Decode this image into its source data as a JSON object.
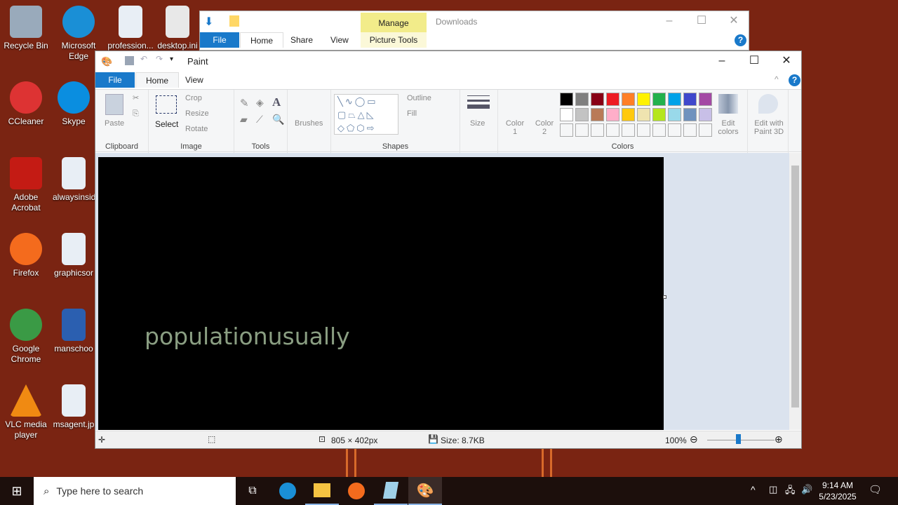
{
  "desktop": {
    "icons": [
      {
        "label": "Recycle Bin",
        "color": "#9ab"
      },
      {
        "label": "Microsoft Edge",
        "color": "#1a8fd6"
      },
      {
        "label": "profession...",
        "color": "#e8eef5"
      },
      {
        "label": "desktop.ini",
        "color": "#e8e8e8"
      },
      {
        "label": "CCleaner",
        "color": "#d33"
      },
      {
        "label": "Skype",
        "color": "#0a8ee0"
      },
      {
        "label": "Adobe Acrobat",
        "color": "#c41b14"
      },
      {
        "label": "alwaysinsid",
        "color": "#e8eef5"
      },
      {
        "label": "Firefox",
        "color": "#f46b1d"
      },
      {
        "label": "graphicsor",
        "color": "#e8eef5"
      },
      {
        "label": "Google Chrome",
        "color": "#3a9a45"
      },
      {
        "label": "manschoo",
        "color": "#2b5fb0"
      },
      {
        "label": "VLC media player",
        "color": "#f08a12"
      },
      {
        "label": "msagent.jp",
        "color": "#e8eef5"
      }
    ]
  },
  "explorer": {
    "manage": "Manage",
    "title": "Downloads",
    "tabs": [
      "File",
      "Home",
      "Share",
      "View"
    ],
    "picture_tools": "Picture Tools"
  },
  "paint": {
    "title": "Paint",
    "tabs": [
      "File",
      "Home",
      "View"
    ],
    "clipboard": {
      "paste": "Paste",
      "label": "Clipboard"
    },
    "image": {
      "select": "Select",
      "crop": "Crop",
      "resize": "Resize",
      "rotate": "Rotate",
      "label": "Image"
    },
    "tools": {
      "label": "Tools"
    },
    "brushes": "Brushes",
    "shapes": {
      "outline": "Outline",
      "fill": "Fill",
      "label": "Shapes"
    },
    "size": "Size",
    "color1": "Color 1",
    "color2": "Color 2",
    "colors_label": "Colors",
    "edit_colors": "Edit colors",
    "edit_3d": "Edit with Paint 3D",
    "palette": [
      "#000000",
      "#7f7f7f",
      "#880015",
      "#ed1c24",
      "#ff7f27",
      "#fff200",
      "#22b14c",
      "#00a2e8",
      "#3f48cc",
      "#a349a4",
      "#ffffff",
      "#c3c3c3",
      "#b97a57",
      "#ffaec9",
      "#ffc90e",
      "#efe4b0",
      "#b5e61d",
      "#99d9ea",
      "#7092be",
      "#c8bfe7"
    ],
    "canvas_text": "populationusually",
    "status": {
      "dimensions": "805 × 402px",
      "size": "Size: 8.7KB",
      "zoom": "100%"
    },
    "zoom_level": 100
  },
  "taskbar": {
    "search_placeholder": "Type here to search",
    "time": "9:14 AM",
    "date": "5/23/2025"
  }
}
